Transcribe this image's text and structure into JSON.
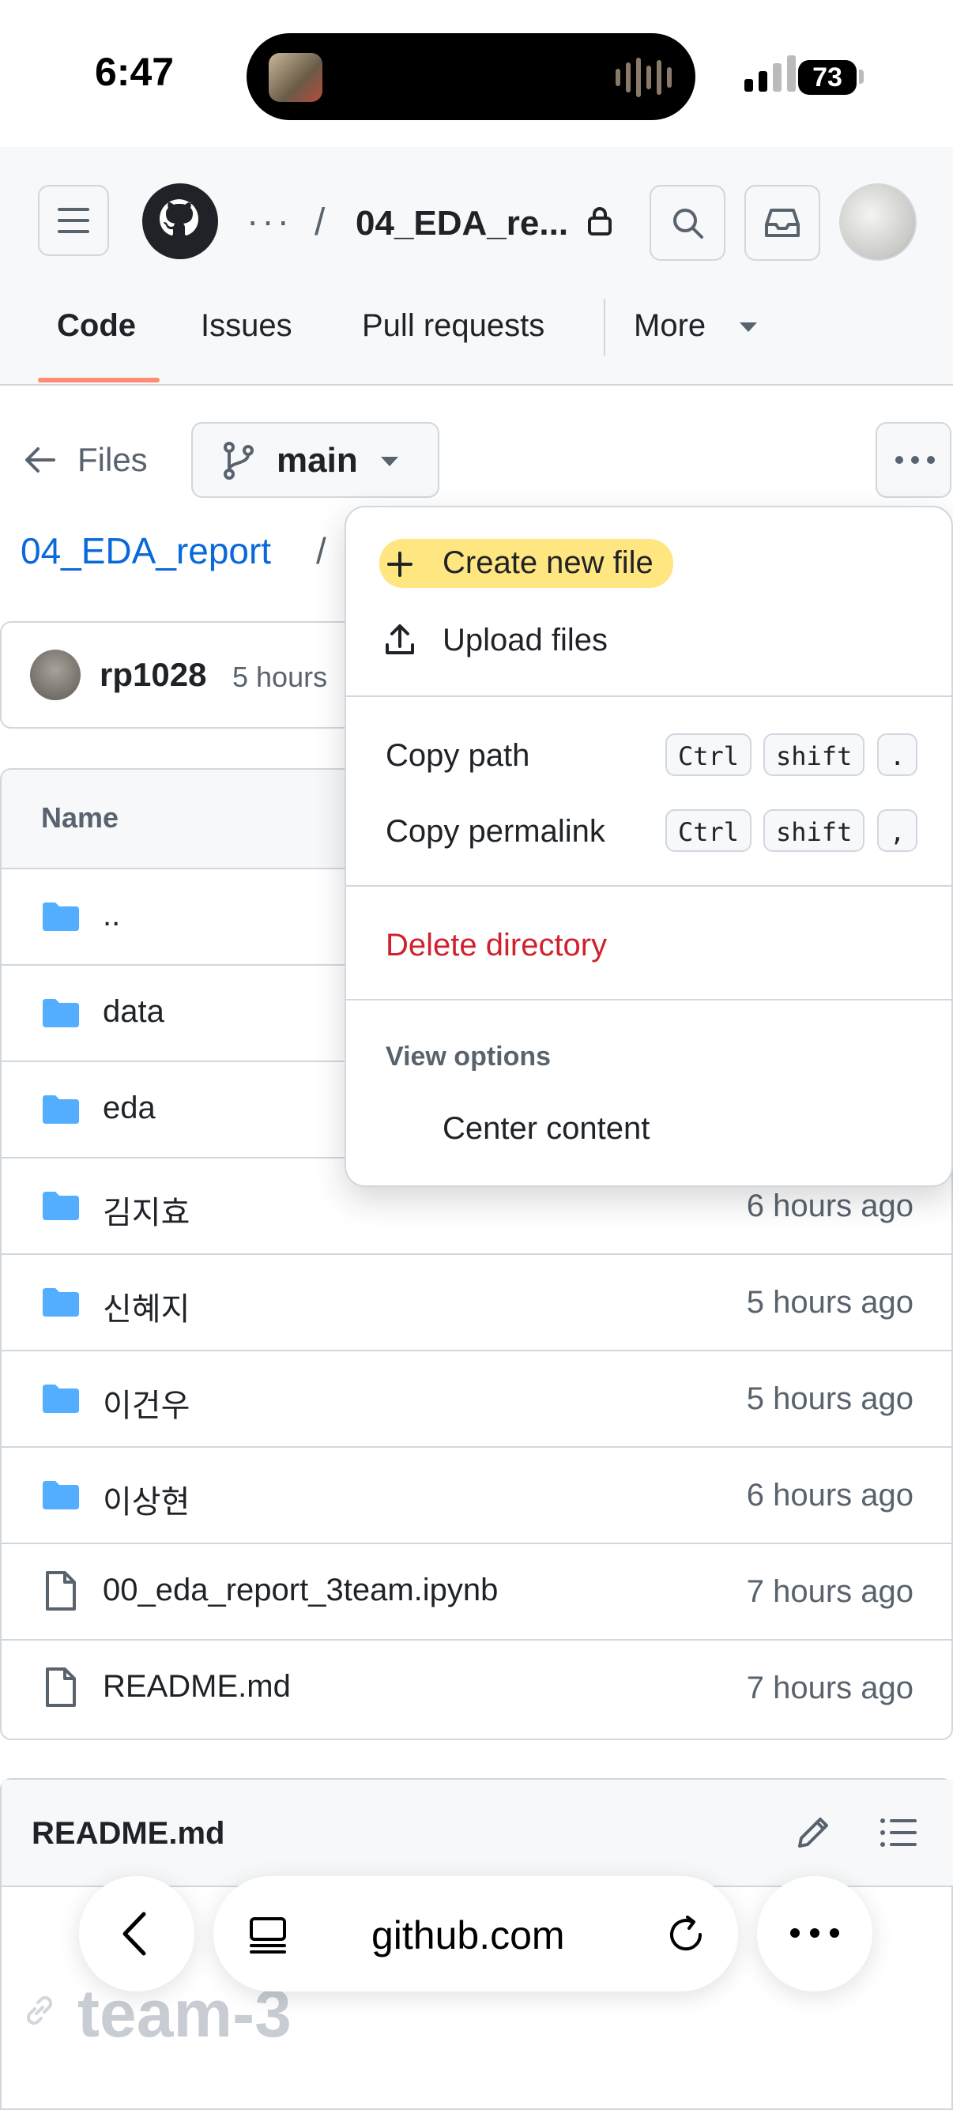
{
  "status": {
    "time": "6:47",
    "battery": "73"
  },
  "header": {
    "breadcrumb_dots": "···",
    "breadcrumb_sep": "/",
    "repo_title": "04_EDA_re..."
  },
  "tabs": [
    {
      "label": "Code",
      "active": true
    },
    {
      "label": "Issues"
    },
    {
      "label": "Pull requests"
    },
    {
      "label": "More"
    }
  ],
  "files_bar": {
    "back_label": "Files",
    "branch": "main"
  },
  "path": {
    "link": "04_EDA_report",
    "sep": "/"
  },
  "commit": {
    "user": "rp1028",
    "time": "5 hours a"
  },
  "table": {
    "header_name": "Name",
    "rows": [
      {
        "name": "..",
        "type": "folder",
        "time": ""
      },
      {
        "name": "data",
        "type": "folder",
        "time": ""
      },
      {
        "name": "eda",
        "type": "folder",
        "time": ""
      },
      {
        "name": "김지효",
        "type": "folder",
        "time": "6 hours ago"
      },
      {
        "name": "신혜지",
        "type": "folder",
        "time": "5 hours ago"
      },
      {
        "name": "이건우",
        "type": "folder",
        "time": "5 hours ago"
      },
      {
        "name": "이상현",
        "type": "folder",
        "time": "6 hours ago"
      },
      {
        "name": "00_eda_report_3team.ipynb",
        "type": "file",
        "time": "7 hours ago"
      },
      {
        "name": "README.md",
        "type": "file",
        "time": "7 hours ago"
      }
    ]
  },
  "menu": {
    "create_new_file": "Create new file",
    "upload_files": "Upload files",
    "copy_path": "Copy path",
    "copy_path_keys": [
      "Ctrl",
      "shift",
      "."
    ],
    "copy_permalink": "Copy permalink",
    "copy_permalink_keys": [
      "Ctrl",
      "shift",
      ","
    ],
    "delete_directory": "Delete directory",
    "view_options": "View options",
    "center_content": "Center content"
  },
  "readme": {
    "title": "README.md",
    "heading": "team-3"
  },
  "browser": {
    "url": "github.com"
  },
  "colors": {
    "link": "#0969da",
    "danger": "#cf222e",
    "tab_underline": "#fd8c73",
    "folder": "#54aeff",
    "highlight": "#ffe680"
  }
}
